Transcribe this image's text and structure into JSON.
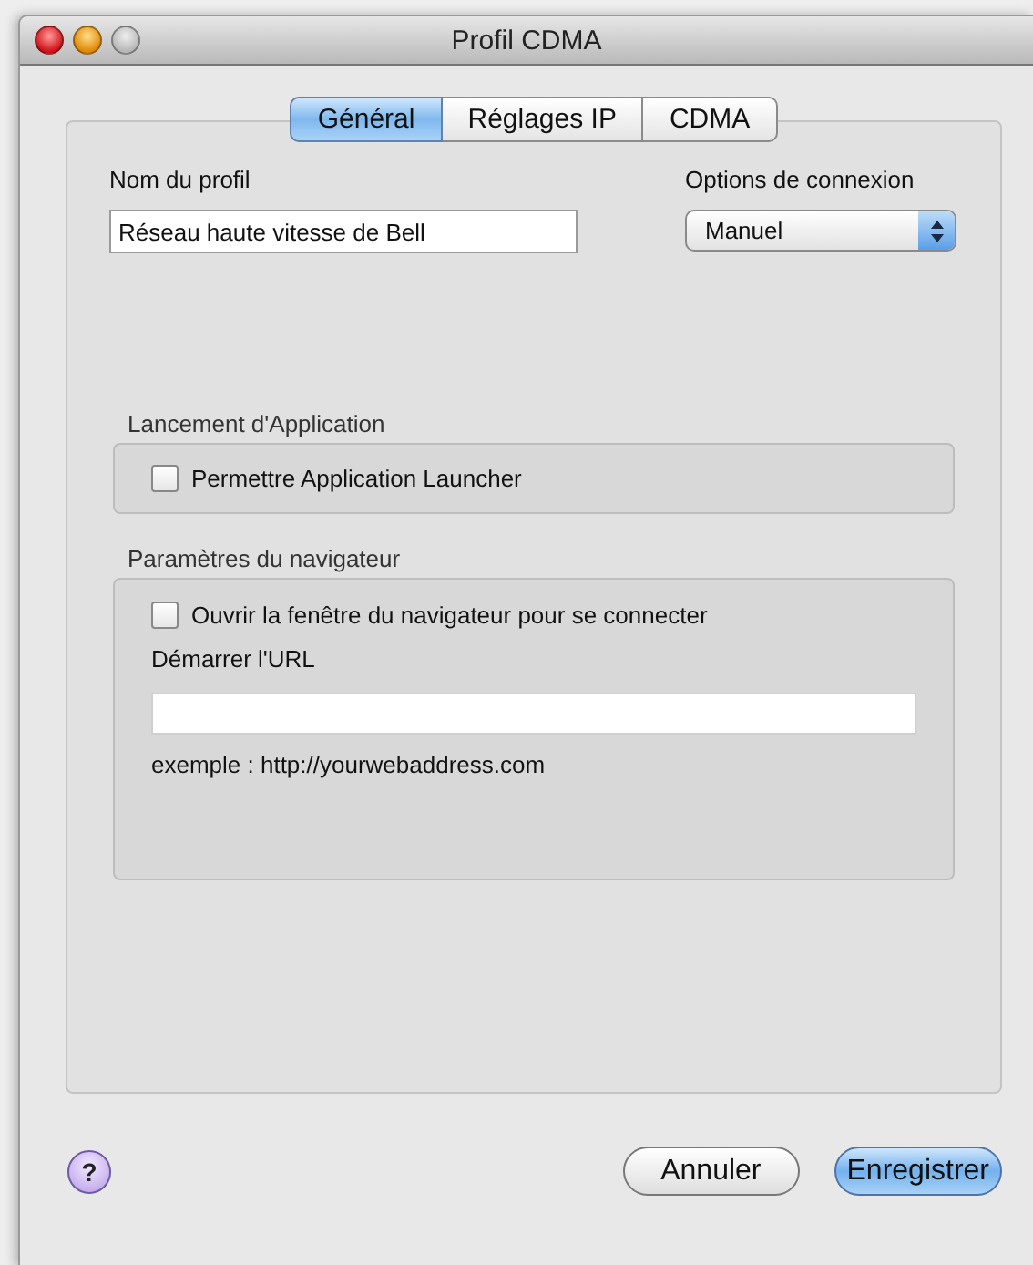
{
  "window": {
    "title": "Profil CDMA"
  },
  "tabs": [
    {
      "label": "Général",
      "selected": true
    },
    {
      "label": "Réglages IP",
      "selected": false
    },
    {
      "label": "CDMA",
      "selected": false
    }
  ],
  "profile_name": {
    "label": "Nom du profil",
    "value": "Réseau haute vitesse de Bell"
  },
  "connection_options": {
    "label": "Options de connexion",
    "value": "Manuel"
  },
  "app_launch": {
    "title": "Lancement d'Application",
    "checkbox": {
      "label": "Permettre Application Launcher",
      "checked": false
    }
  },
  "browser_settings": {
    "title": "Paramètres du navigateur",
    "checkbox": {
      "label": "Ouvrir la fenêtre du navigateur pour se connecter",
      "checked": false
    },
    "url_label": "Démarrer l'URL",
    "example": "exemple : http://yourwebaddress.com"
  },
  "help": "?",
  "buttons": [
    {
      "label": "Annuler",
      "default": false
    },
    {
      "label": "Enregistrer",
      "default": true
    }
  ]
}
